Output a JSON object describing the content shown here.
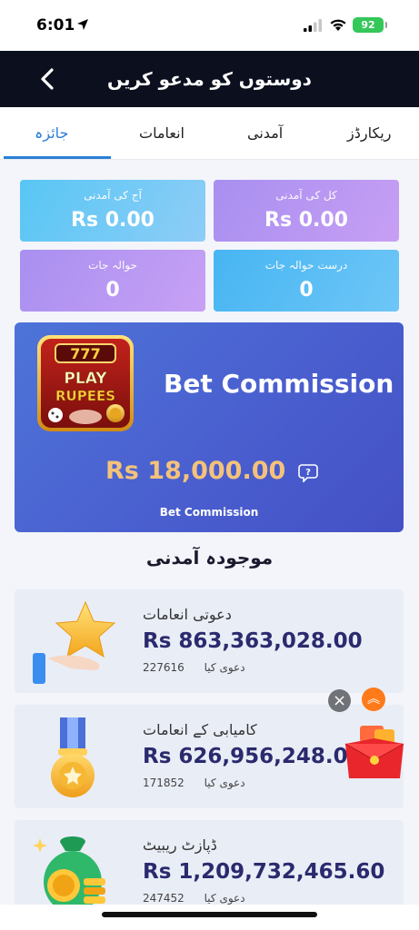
{
  "status_bar": {
    "time": "6:01",
    "battery": "92"
  },
  "header": {
    "title": "دوستوں کو مدعو کریں"
  },
  "tabs": [
    {
      "label": "ریکارڈز"
    },
    {
      "label": "آمدنی"
    },
    {
      "label": "انعامات"
    },
    {
      "label": "جائزہ"
    }
  ],
  "stats": {
    "today": {
      "label": "آج کی آمدنی",
      "value": "Rs 0.00"
    },
    "yesterday": {
      "label": "کل کی آمدنی",
      "value": "Rs 0.00"
    },
    "referrals": {
      "label": "حوالہ جات",
      "value": "0"
    },
    "valid_referrals": {
      "label": "درست حوالہ جات",
      "value": "0"
    }
  },
  "bet_commission": {
    "logo_text_top": "PLAY",
    "logo_text_bottom": "RUPEES",
    "title": "Bet Commission",
    "amount": "Rs 18,000.00",
    "subtitle": "Bet Commission"
  },
  "section_title": "موجودہ آمدنی",
  "income_cards": [
    {
      "title": "دعوتی انعامات",
      "amount": "Rs 863,363,028.00",
      "count": "227616",
      "count_label": "دعوی کیا"
    },
    {
      "title": "کامیابی کے انعامات",
      "amount": "Rs 626,956,248.00",
      "count": "171852",
      "count_label": "دعوی کیا"
    },
    {
      "title": "ڈپازٹ ریبیٹ",
      "amount": "Rs 1,209,732,465.60",
      "count": "247452",
      "count_label": "دعوی کیا"
    }
  ],
  "floating": {
    "close": "×",
    "up": "︽"
  },
  "colors": {
    "accent": "#2b7fd6",
    "header_bg": "#0b0f1e",
    "amount_gold": "#f4c27a",
    "amount_navy": "#2b2a6e"
  }
}
